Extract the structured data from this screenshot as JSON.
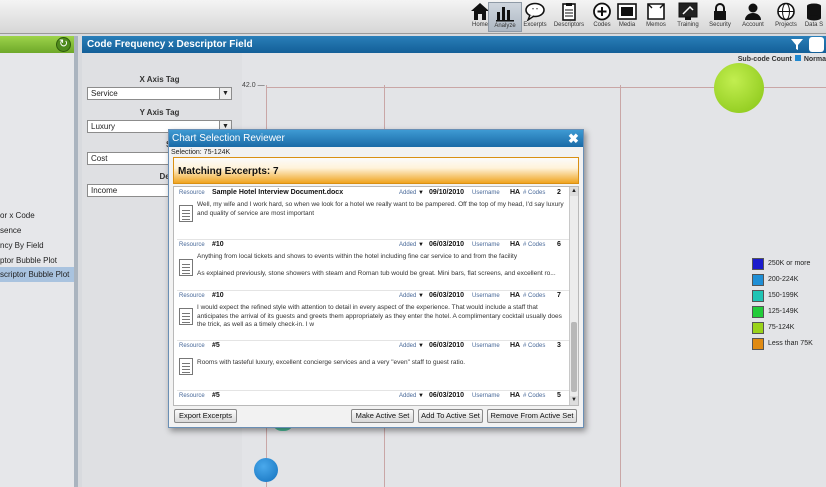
{
  "toolbar": {
    "items": [
      {
        "label": "Home",
        "icon": "home-icon"
      },
      {
        "label": "Analyze",
        "icon": "bar-chart-icon",
        "active": true
      },
      {
        "label": "Excerpts",
        "icon": "speech-bubble-icon"
      },
      {
        "label": "Descriptors",
        "icon": "clipboard-icon"
      },
      {
        "label": "Codes",
        "icon": "plus-circle-icon"
      },
      {
        "label": "Media",
        "icon": "film-icon"
      },
      {
        "label": "Memos",
        "icon": "memo-icon"
      },
      {
        "label": "Training",
        "icon": "training-icon"
      },
      {
        "label": "Security",
        "icon": "lock-icon"
      },
      {
        "label": "Account",
        "icon": "person-icon"
      },
      {
        "label": "Projects",
        "icon": "globe-icon"
      },
      {
        "label": "Data S",
        "icon": "database-icon"
      }
    ]
  },
  "left_panel": {
    "items": [
      "or x Code",
      "sence",
      "ncy By Field",
      "ptor Bubble Plot",
      "scriptor Bubble Plot"
    ],
    "selected_index": 4
  },
  "main": {
    "title": "Code Frequency x Descriptor Field",
    "controls": {
      "x_axis_label": "X Axis Tag",
      "x_axis_value": "Service",
      "y_axis_label": "Y Axis Tag",
      "y_axis_value": "Luxury",
      "size_label": "Size Ta",
      "size_value": "Cost",
      "descriptor_label": "Descriptor",
      "descriptor_value": "Income"
    },
    "subcode_label": "Sub-code Count",
    "normalize_label": "Norma",
    "y_tick": "42.0",
    "legend": [
      {
        "label": "250K or more",
        "color": "#1a1acc"
      },
      {
        "label": "200-224K",
        "color": "#1f8fd6"
      },
      {
        "label": "150-199K",
        "color": "#1fc4b4"
      },
      {
        "label": "125-149K",
        "color": "#22cc3a"
      },
      {
        "label": "75-124K",
        "color": "#9ad31a"
      },
      {
        "label": "Less than 75K",
        "color": "#e08a12"
      }
    ]
  },
  "modal": {
    "title": "Chart Selection Reviewer",
    "selection": "Selection: 75-124K",
    "matching": "Matching Excerpts: 7",
    "excerpts": [
      {
        "resource_label": "Resource",
        "resource": "Sample Hotel Interview Document.docx",
        "added_label": "Added",
        "date": "09/10/2010",
        "username_label": "Username",
        "user": "HA",
        "codes_label": "# Codes",
        "codes": "2",
        "text": "Well, my wife and I work hard, so when we look for a hotel we really want to be pampered.  Off the top of my head, I'd say luxury and quality of service are most important"
      },
      {
        "resource_label": "Resource",
        "resource": "#10",
        "added_label": "Added",
        "date": "06/03/2010",
        "username_label": "Username",
        "user": "HA",
        "codes_label": "# Codes",
        "codes": "6",
        "text": "Anything from local tickets and shows to events within the hotel including fine car service to and from the facility",
        "text2": "As explained previously, stone showers with steam and Roman tub would be great. Mini bars, flat screens, and excellent ro..."
      },
      {
        "resource_label": "Resource",
        "resource": "#10",
        "added_label": "Added",
        "date": "06/03/2010",
        "username_label": "Username",
        "user": "HA",
        "codes_label": "# Codes",
        "codes": "7",
        "text": "I would expect the refined style with attention to detail in every aspect of the experience. That would include a staff that anticipates the arrival of its guests and greets them appropriately as they enter the hotel. A complimentary cocktail usually does the trick, as well as a timely check-in. I w"
      },
      {
        "resource_label": "Resource",
        "resource": "#5",
        "added_label": "Added",
        "date": "06/03/2010",
        "username_label": "Username",
        "user": "HA",
        "codes_label": "# Codes",
        "codes": "3",
        "text": "Rooms with tasteful luxury, excellent concierge services and a very \"even\" staff to guest ratio."
      },
      {
        "resource_label": "Resource",
        "resource": "#5",
        "added_label": "Added",
        "date": "06/03/2010",
        "username_label": "Username",
        "user": "HA",
        "codes_label": "# Codes",
        "codes": "5",
        "text": ""
      }
    ],
    "buttons": {
      "export": "Export Excerpts",
      "make_active": "Make Active Set",
      "add_active": "Add To Active Set",
      "remove_active": "Remove From Active Set"
    }
  }
}
